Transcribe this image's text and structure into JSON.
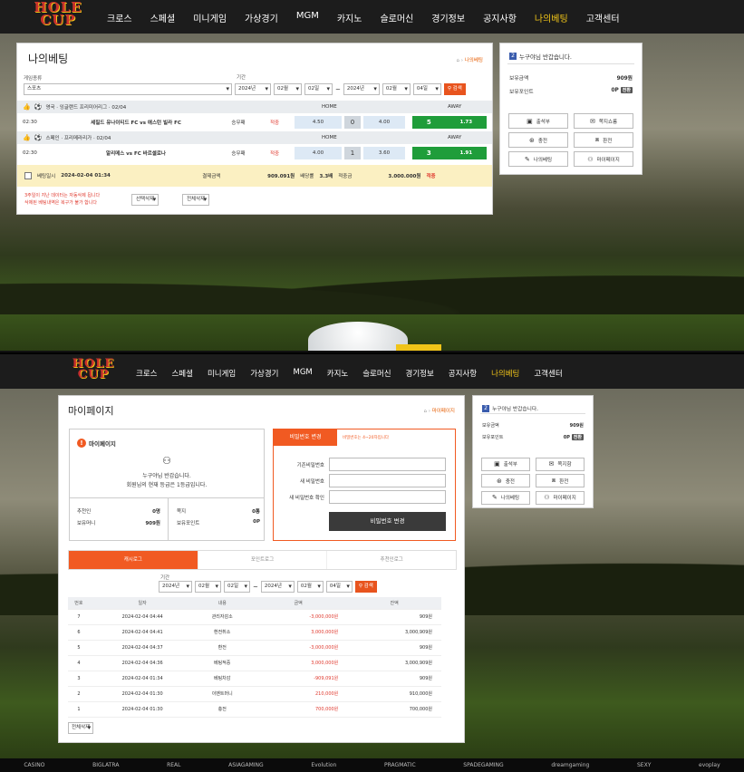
{
  "brand": {
    "logo_line1": "HOLE",
    "logo_line2": "CUP"
  },
  "nav": [
    "크로스",
    "스페셜",
    "미니게임",
    "가상경기",
    "MGM",
    "카지노",
    "슬로머신",
    "경기정보",
    "공지사항",
    "나의베팅",
    "고객센터"
  ],
  "nav_active_index": 9,
  "top": {
    "title": "나의베팅",
    "breadcrumb": "나의베팅",
    "game_type_label": "게임종류",
    "game_type_value": "스포츠",
    "period_label": "기간",
    "from": {
      "year": "2024년",
      "month": "02월",
      "day": "02일"
    },
    "to": {
      "year": "2024년",
      "month": "02월",
      "day": "04일"
    },
    "tilde": "~",
    "search_label": "검색",
    "home_header": "HOME",
    "away_header": "AWAY",
    "bets": [
      {
        "sport_icon": "soccer-icon",
        "league": "영국 · 잉글랜드 프리미어리그 · 02/04",
        "time": "02:30",
        "match": "셰필드 유나이티드 FC vs 애스턴 빌라 FC",
        "market": "승무패",
        "result": "적중",
        "home": "4.50",
        "draw": "0",
        "away": "4.00",
        "pick": "5",
        "pick_odds": "1.73"
      },
      {
        "sport_icon": "soccer-icon",
        "league": "스페인 · 프리메라리가 · 02/04",
        "time": "02:30",
        "match": "알리메스 vs FC 바르셀로나",
        "market": "승무패",
        "result": "적중",
        "home": "4.00",
        "draw": "1",
        "away": "3.60",
        "pick": "3",
        "pick_odds": "1.91"
      }
    ],
    "summary": {
      "date_label": "베팅일시",
      "date": "2024-02-04 01:34",
      "amount_label": "결제금액",
      "amount": "909.091원",
      "odds_label": "배당률",
      "odds": "3.3배",
      "win_label": "적중금",
      "win": "3.000.000원",
      "status": "적중"
    },
    "note_line1": "3주일이 지난 데이터는 자동삭제 됩니다",
    "note_line2": "삭제된 베팅내역은 복구가 불가 합니다",
    "btn_select_delete": "선택삭제",
    "btn_all_delete": "전체삭제"
  },
  "side": {
    "greeting": "누구야님 반갑습니다.",
    "balance_label": "보유금액",
    "balance": "909원",
    "points_label": "보유포인트",
    "points": "0P",
    "convert": "전환",
    "buttons": [
      {
        "icon": "calendar-icon",
        "label": "출석부"
      },
      {
        "icon": "mail-icon",
        "label": "쪽지쇼룸"
      },
      {
        "icon": "coin-icon",
        "label": "충전"
      },
      {
        "icon": "exchange-icon",
        "label": "환전"
      },
      {
        "icon": "bet-icon",
        "label": "나의베팅"
      },
      {
        "icon": "user-icon",
        "label": "마이페이지"
      }
    ]
  },
  "side2": {
    "greeting": "누구야님 반갑습니다.",
    "balance_label": "보유금액",
    "balance": "909원",
    "points_label": "보유포인트",
    "points": "0P",
    "convert": "전환",
    "buttons": [
      {
        "icon": "calendar-icon",
        "label": "출석부"
      },
      {
        "icon": "mail-icon",
        "label": "쪽지함"
      },
      {
        "icon": "coin-icon",
        "label": "충전"
      },
      {
        "icon": "exchange-icon",
        "label": "환전"
      },
      {
        "icon": "bet-icon",
        "label": "나의베팅"
      },
      {
        "icon": "user-icon",
        "label": "마이페이지"
      }
    ]
  },
  "mypage": {
    "title": "마이페이지",
    "breadcrumb": "마이페이지",
    "box_title": "마이페이지",
    "welcome": "누구야님 반갑습니다.",
    "level_text": "회원님의 현재 등급은 1등급입니다.",
    "stats": [
      [
        "추천인",
        "0명"
      ],
      [
        "쪽지",
        "0통"
      ],
      [
        "보유머니",
        "909원"
      ],
      [
        "보유포인트",
        "0P"
      ]
    ],
    "pw_tab": "비밀번호 변경",
    "pw_hint": "비밀번호는 4~20자입니다",
    "pw_fields": [
      "기존비밀번호",
      "새 비밀번호",
      "새 비밀번호 확인"
    ],
    "pw_button": "비밀번호 변경",
    "tabs": [
      "캐시로그",
      "포인트로그",
      "추천인로그"
    ],
    "period_label": "기간",
    "from": {
      "year": "2024년",
      "month": "02월",
      "day": "02일"
    },
    "to": {
      "year": "2024년",
      "month": "02월",
      "day": "04일"
    },
    "tilde": "~",
    "search_label": "검색",
    "columns": [
      "번호",
      "일자",
      "내용",
      "금액",
      "잔액"
    ],
    "rows": [
      [
        "7",
        "2024-02-04 04:44",
        "관리자감소",
        "-3,000,000원",
        "909원"
      ],
      [
        "6",
        "2024-02-04 04:41",
        "환전취소",
        "3,000,000원",
        "3,000,909원"
      ],
      [
        "5",
        "2024-02-04 04:37",
        "환전",
        "-3,000,000원",
        "909원"
      ],
      [
        "4",
        "2024-02-04 04:36",
        "베팅적중",
        "3,000,000원",
        "3,000,909원"
      ],
      [
        "3",
        "2024-02-04 01:34",
        "베팅차감",
        "-909,091원",
        "909원"
      ],
      [
        "2",
        "2024-02-04 01:30",
        "이벤트머니",
        "210,000원",
        "910,000원"
      ],
      [
        "1",
        "2024-02-04 01:30",
        "충전",
        "700,000원",
        "700,000원"
      ]
    ],
    "delete_all": "전체삭제"
  },
  "footer_brands": [
    "CASINO",
    "BIGLATRA",
    "REAL",
    "ASIAGAMING",
    "Evolution",
    "PRAGMATIC",
    "SPADEGAMING",
    "dreamgaming",
    "SEXY",
    "evoplay"
  ]
}
